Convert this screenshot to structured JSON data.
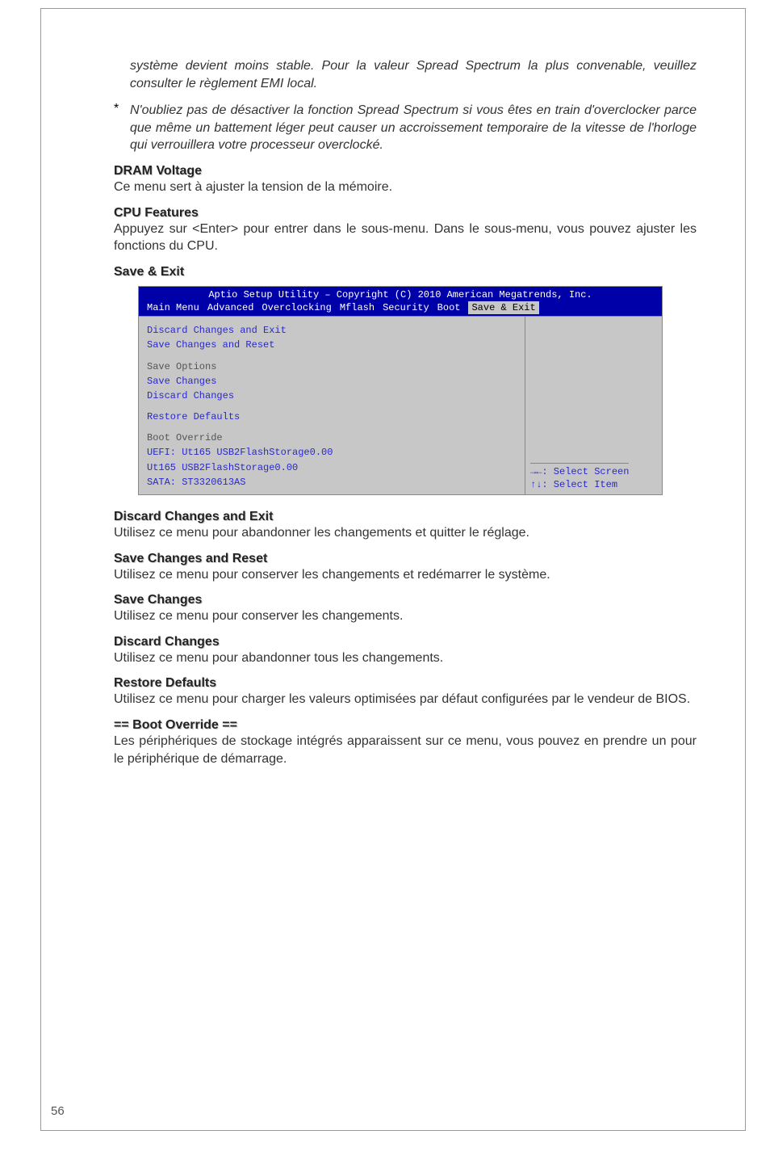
{
  "intro_continued": "système devient moins stable. Pour la valeur Spread Spectrum la plus conven­able, veuillez consulter le règlement EMI local.",
  "bullet1": "N'oubliez pas de désactiver la fonction Spread Spectrum si vous êtes en train d'overclocker parce que même un battement léger peut causer un accroisse­ment temporaire de la vitesse de l'horloge qui verrouillera votre processeur overclocké.",
  "h_dram": "DRAM Voltage",
  "p_dram": "Ce menu sert à ajuster la tension de la mémoire.",
  "h_cpu": "CPU Features",
  "p_cpu": "Appuyez sur <Enter> pour entrer dans le sous-menu. Dans le sous-menu, vous pouvez ajuster les fonctions du CPU.",
  "h_save_exit": "Save & Exit",
  "bios": {
    "title": "Aptio Setup Utility – Copyright (C) 2010 American Megatrends, Inc.",
    "tabs": {
      "main": "Main Menu",
      "advanced": "Advanced",
      "overclocking": "Overclocking",
      "mflash": "Mflash",
      "security": "Security",
      "boot": "Boot",
      "save_exit": "Save & Exit"
    },
    "items": {
      "discard_exit": "Discard Changes and Exit",
      "save_reset": "Save Changes and Reset",
      "save_options": "Save Options",
      "save_changes": "Save Changes",
      "discard_changes": "Discard Changes",
      "restore_defaults": "Restore Defaults",
      "boot_override": "Boot Override",
      "uefi_usb": "UEFI: Ut165 USB2FlashStorage0.00",
      "usb": "Ut165 USB2FlashStorage0.00",
      "sata": "SATA: ST3320613AS"
    },
    "help": {
      "l1": "→←: Select Screen",
      "l2": "↑↓: Select Item"
    }
  },
  "h_discard_exit": "Discard Changes and Exit",
  "p_discard_exit": "Utilisez ce menu pour abandonner les changements et quitter le réglage.",
  "h_save_reset": "Save Changes and Reset",
  "p_save_reset": "Utilisez ce menu pour conserver les changements et redémarrer le système.",
  "h_save_changes": "Save Changes",
  "p_save_changes": "Utilisez ce menu pour conserver les changements.",
  "h_discard_changes": "Discard Changes",
  "p_discard_changes": "Utilisez ce menu pour abandonner tous les changements.",
  "h_restore": "Restore Defaults",
  "p_restore": "Utilisez ce menu pour charger les valeurs optimisées par défaut configurées par le vendeur de BIOS.",
  "h_boot_override": "== Boot Override ==",
  "p_boot_override": "Les périphériques de stockage intégrés apparaissent sur ce menu, vous pouvez en prendre un pour le périphérique de démarrage.",
  "page_number": "56"
}
